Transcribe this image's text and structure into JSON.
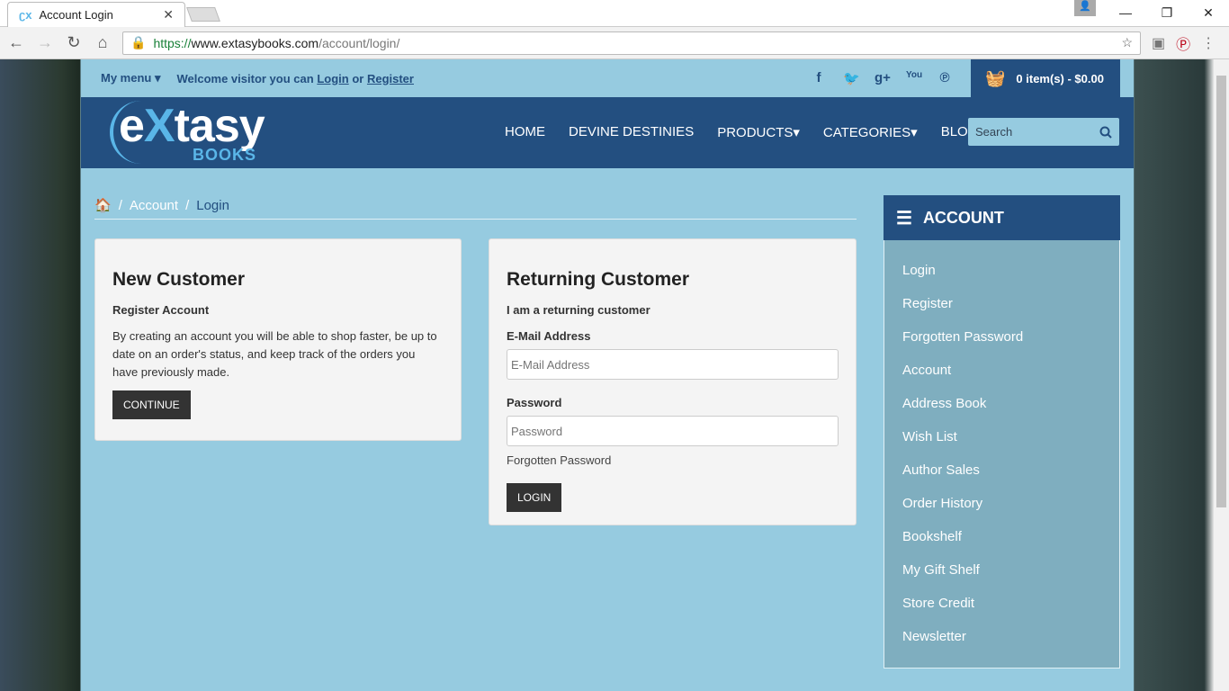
{
  "browser": {
    "tab_title": "Account Login",
    "url_scheme": "https://",
    "url_domain": "www.extasybooks.com",
    "url_path": "/account/login/"
  },
  "topbar": {
    "my_menu": "My menu",
    "welcome": "Welcome visitor you can",
    "login": "Login",
    "or": "or",
    "register": "Register",
    "cart": "0 item(s) - $0.00",
    "social": [
      "facebook-icon",
      "twitter-icon",
      "google-plus-icon",
      "youtube-icon",
      "pinterest-icon"
    ]
  },
  "logo": {
    "text_e": "e",
    "text_x": "X",
    "text_rest": "tasy",
    "books": "BOOKS"
  },
  "nav": [
    "HOME",
    "DEVINE DESTINIES",
    "PRODUCTS",
    "CATEGORIES",
    "BLOG"
  ],
  "search": {
    "placeholder": "Search"
  },
  "breadcrumb": [
    "Account",
    "Login"
  ],
  "new_customer": {
    "title": "New Customer",
    "subtitle": "Register Account",
    "text": "By creating an account you will be able to shop faster, be up to date on an order's status, and keep track of the orders you have previously made.",
    "button": "CONTINUE"
  },
  "returning": {
    "title": "Returning Customer",
    "subtitle": "I am a returning customer",
    "email_label": "E-Mail Address",
    "email_placeholder": "E-Mail Address",
    "password_label": "Password",
    "password_placeholder": "Password",
    "forgot": "Forgotten Password",
    "button": "LOGIN"
  },
  "sidebar": {
    "title": "ACCOUNT",
    "items": [
      "Login",
      "Register",
      "Forgotten Password",
      "Account",
      "Address Book",
      "Wish List",
      "Author Sales",
      "Order History",
      "Bookshelf",
      "My Gift Shelf",
      "Store Credit",
      "Newsletter"
    ]
  },
  "colors": {
    "light": "#96cbe0",
    "dark": "#234f80",
    "sidebar": "#7faebf"
  }
}
